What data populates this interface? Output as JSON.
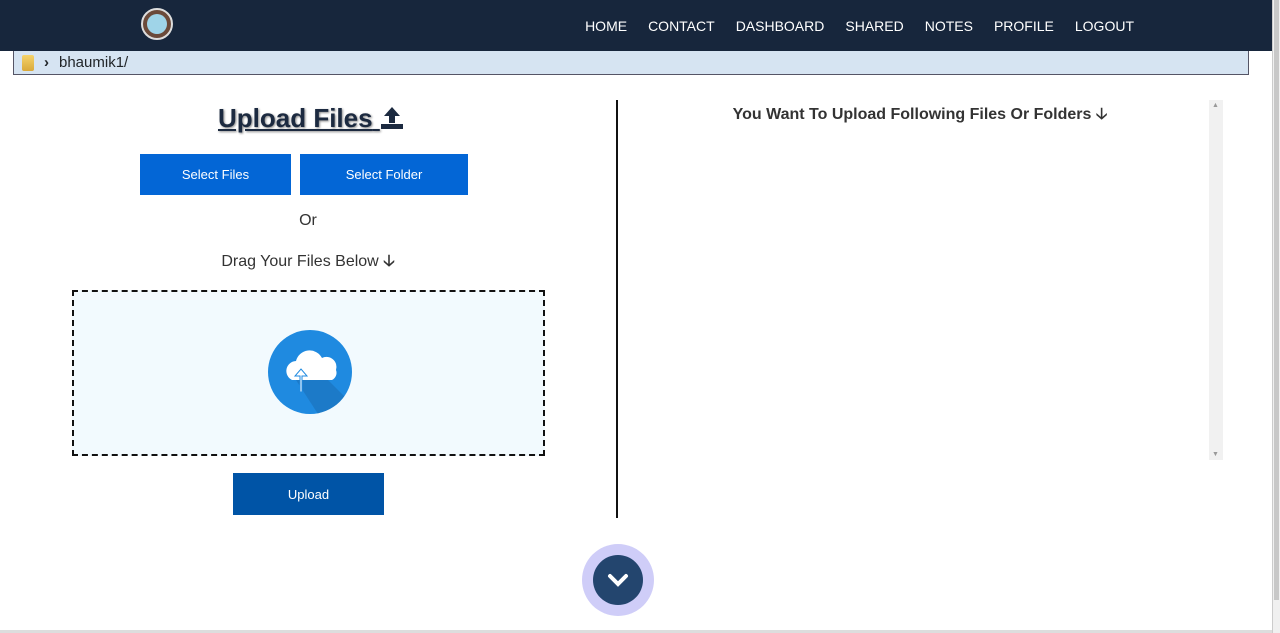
{
  "nav": {
    "items": [
      "HOME",
      "CONTACT",
      "DASHBOARD",
      "SHARED",
      "NOTES",
      "PROFILE",
      "LOGOUT"
    ]
  },
  "breadcrumb": {
    "path": "bhaumik1/"
  },
  "upload": {
    "title": "Upload Files",
    "select_files": "Select Files",
    "select_folder": "Select Folder",
    "or": "Or",
    "drag": "Drag Your Files Below",
    "upload_button": "Upload"
  },
  "right": {
    "title": "You Want To Upload Following Files Or Folders"
  },
  "colors": {
    "nav": "#17263c",
    "button": "#0366d6",
    "upload_button": "#0054a6",
    "drop_bg": "#f2fafe"
  }
}
